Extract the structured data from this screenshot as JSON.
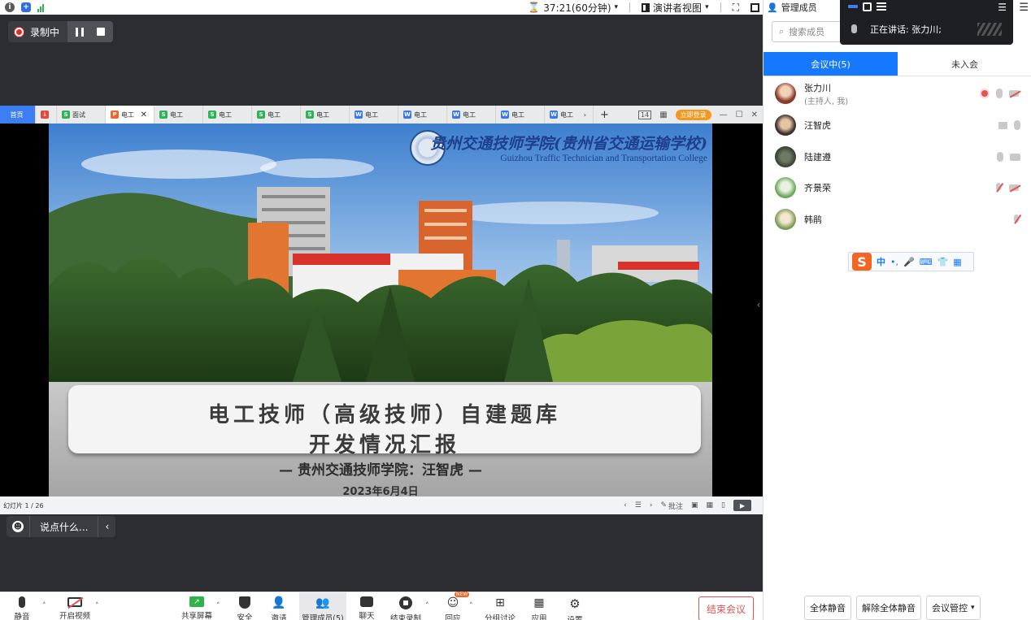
{
  "topbar": {
    "timer": "37:21(60分钟)",
    "view_mode": "演讲者视图"
  },
  "recording": {
    "status": "录制中"
  },
  "shared_app": {
    "home_tab": "首页",
    "tabs": [
      "面试",
      "电工",
      "电工",
      "电工",
      "电工",
      "电工",
      "电工",
      "电工",
      "电工",
      "电工",
      "电工"
    ],
    "login_label": "立即登录"
  },
  "slide": {
    "college_cn": "贵州交通技师学院(贵州省交通运输学校)",
    "college_en": "Guizhou Traffic Technician and Transportation College",
    "title_line1": "电工技师（高级技师）自建题库",
    "title_line2": "开发情况汇报",
    "presenter": "— 贵州交通技师学院：汪智虎 —",
    "date": "2023年6月4日",
    "page_indicator": "幻灯片 1 / 26",
    "note_label": "批注"
  },
  "chat": {
    "placeholder": "说点什么..."
  },
  "toolbar": {
    "mute": "静音",
    "video": "开启视频",
    "share": "共享屏幕",
    "security": "安全",
    "invite": "邀请",
    "members": "管理成员(5)",
    "chat": "聊天",
    "end_record": "结束录制",
    "reactions": "回应",
    "reactions_badge": "NEW",
    "breakout": "分组讨论",
    "apps": "应用",
    "settings": "设置",
    "end_meeting": "结束会议"
  },
  "panel": {
    "title": "管理成员",
    "search_placeholder": "搜索成员",
    "speaking_label": "正在讲话:",
    "speaking_name": "张力川;",
    "tab_in": "会议中(5)",
    "tab_out": "未入会",
    "members": [
      {
        "name": "张力川",
        "role": "(主持人, 我)"
      },
      {
        "name": "汪智虎",
        "role": ""
      },
      {
        "name": "陆建遵",
        "role": ""
      },
      {
        "name": "齐景荣",
        "role": ""
      },
      {
        "name": "韩鹃",
        "role": ""
      }
    ],
    "ime_items": [
      "中",
      "•,",
      "🎤",
      "⌨",
      "👕",
      "▦"
    ],
    "mute_all": "全体静音",
    "unmute_all": "解除全体静音",
    "control": "会议管控"
  },
  "colors": {
    "accent": "#1677ff",
    "danger": "#e45353",
    "record": "#e02b2b",
    "ime_logo": "#f26522"
  }
}
